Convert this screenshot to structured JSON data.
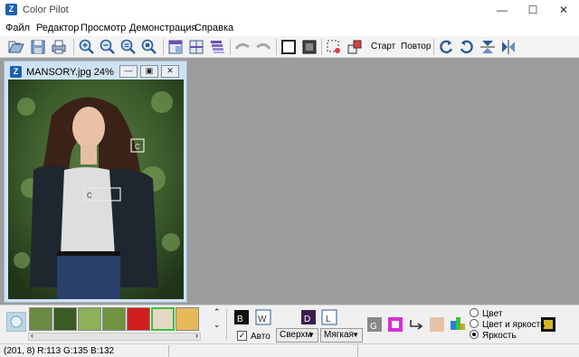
{
  "window": {
    "title": "Color Pilot",
    "app_icon": "app-logo-icon"
  },
  "menu": [
    "Файл",
    "Редактор",
    "Просмотр",
    "Демонстрация",
    "Справка"
  ],
  "toolbar": {
    "start_label": "Старт",
    "repeat_label": "Повтор",
    "icons": [
      "open-icon",
      "save-icon",
      "print-icon",
      "zoom-in-icon",
      "zoom-out-icon",
      "zoom-fit-icon",
      "zoom-actual-icon",
      "split-view-icon",
      "compare-view-icon",
      "layers-icon",
      "undo-icon",
      "redo-icon",
      "frame-icon",
      "frame-filled-icon",
      "select-area-icon",
      "resize-icon",
      "rotate-left-icon",
      "rotate-right-icon",
      "flip-vertical-icon",
      "flip-horizontal-icon"
    ]
  },
  "child_window": {
    "title": "MANSORY.jpg 24%",
    "markers": [
      "C",
      "C"
    ]
  },
  "bottom_panel": {
    "swatch_colors": [
      "#6b8a44",
      "#3c5a25",
      "#8db05a",
      "#6f9340",
      "#d21d1d",
      "#e6d6c4",
      "#e8b85a"
    ],
    "auto_label": "Авто",
    "auto_checked": true,
    "combo_1": "Сверхм",
    "combo_2": "Мягкая",
    "radio_options": [
      "Цвет",
      "Цвет и яркость",
      "Яркость"
    ],
    "radio_selected": 2
  },
  "status": {
    "text": "(201, 8) R:113 G:135 B:132"
  }
}
